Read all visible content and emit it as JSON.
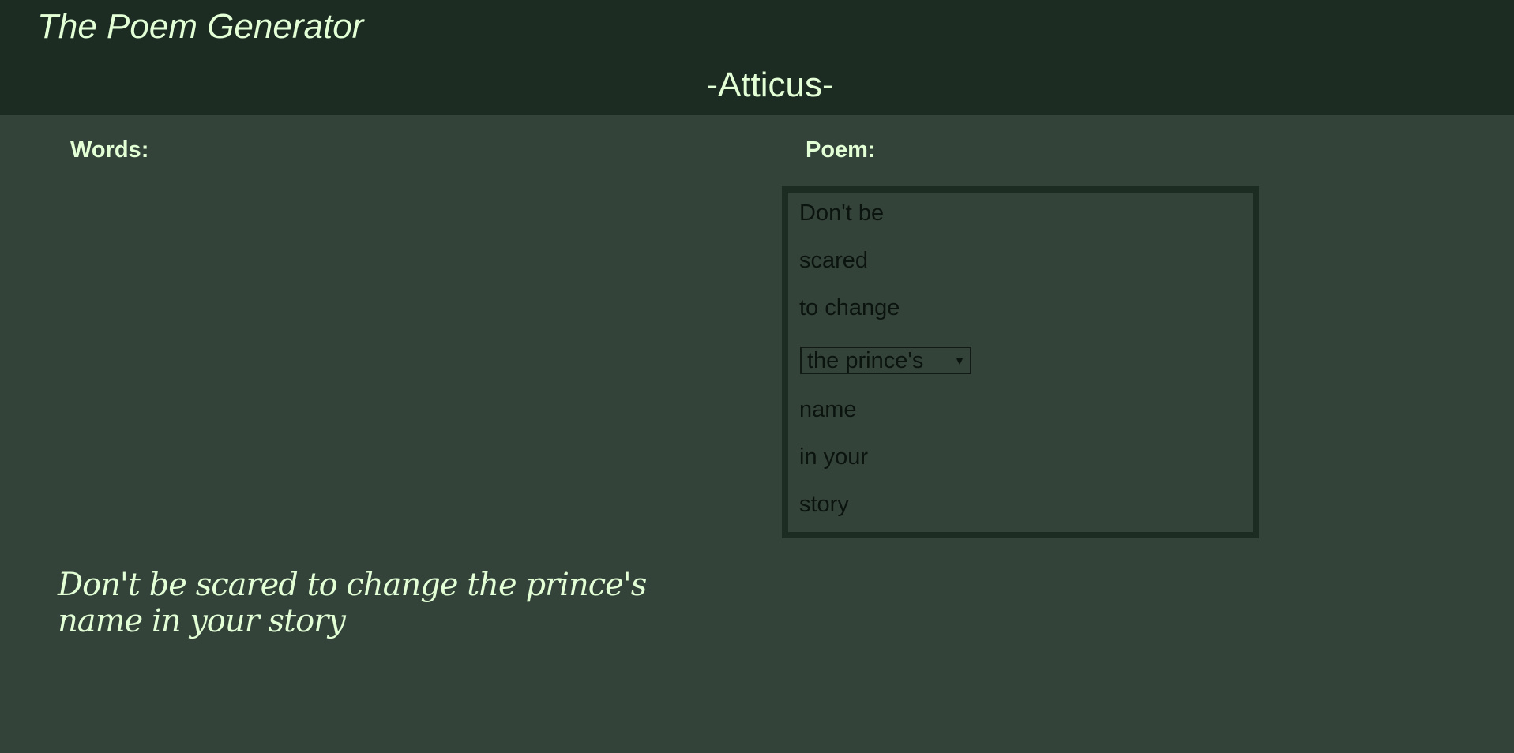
{
  "header": {
    "app_title": "The Poem Generator",
    "author": "-Atticus-"
  },
  "words_section": {
    "label": "Words:",
    "items": []
  },
  "poem_section": {
    "label": "Poem:",
    "lines": {
      "line1": "Don't be",
      "line2": "scared",
      "line3": "to change",
      "line5": "name",
      "line6": "in your",
      "line7": "story"
    },
    "select": {
      "selected": "the prince's",
      "arrow": "▼"
    }
  },
  "output": {
    "text": "Don't be scared to change the prince's name in your story"
  },
  "colors": {
    "background": "#34433a",
    "header_bg": "#1d2c23",
    "accent_text": "#e3ffd6",
    "poem_text": "#0b130e"
  }
}
